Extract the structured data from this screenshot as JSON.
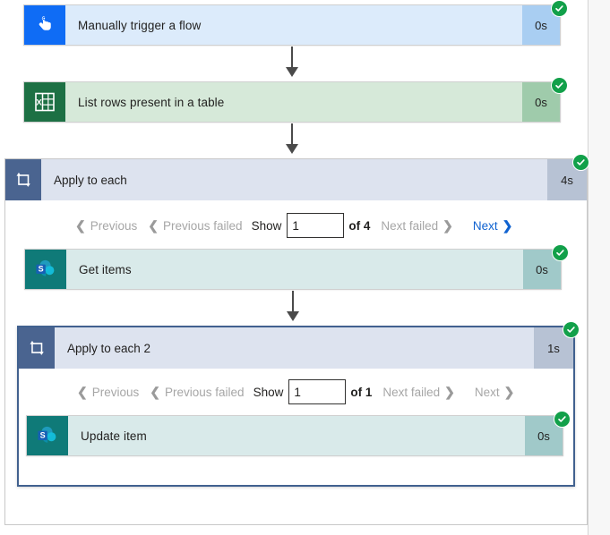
{
  "flow": {
    "steps": [
      {
        "id": "manually-trigger-a-flow",
        "title": "Manually trigger a flow",
        "duration": "0s",
        "icon": "touch-hand-icon",
        "status": "succeeded"
      },
      {
        "id": "list-rows-present-in-a-table",
        "title": "List rows present in a table",
        "duration": "0s",
        "icon": "excel-icon",
        "status": "succeeded"
      },
      {
        "id": "apply-to-each",
        "title": "Apply to each",
        "duration": "4s",
        "icon": "loop-icon",
        "status": "succeeded",
        "pager": {
          "previous_label": "Previous",
          "previous_failed_label": "Previous failed",
          "show_label": "Show",
          "page_value": "1",
          "of_label": "of",
          "total_pages": "4",
          "next_failed_label": "Next failed",
          "next_label": "Next",
          "previous_enabled": false,
          "previous_failed_enabled": false,
          "next_failed_enabled": false,
          "next_enabled": true
        }
      },
      {
        "id": "get-items",
        "title": "Get items",
        "duration": "0s",
        "icon": "sharepoint-icon",
        "status": "succeeded"
      },
      {
        "id": "apply-to-each-2",
        "title": "Apply to each 2",
        "duration": "1s",
        "icon": "loop-icon",
        "status": "succeeded",
        "pager": {
          "previous_label": "Previous",
          "previous_failed_label": "Previous failed",
          "show_label": "Show",
          "page_value": "1",
          "of_label": "of",
          "total_pages": "1",
          "next_failed_label": "Next failed",
          "next_label": "Next",
          "previous_enabled": false,
          "previous_failed_enabled": false,
          "next_failed_enabled": false,
          "next_enabled": false
        }
      },
      {
        "id": "update-item",
        "title": "Update item",
        "duration": "0s",
        "icon": "sharepoint-icon",
        "status": "succeeded"
      }
    ]
  },
  "colors": {
    "trigger_card": "#dcebfb",
    "trigger_duration": "#a9cef2",
    "excel_card": "#d6e9d9",
    "excel_duration": "#9fcbab",
    "sharepoint_card": "#d9eaea",
    "sharepoint_duration": "#a0c9c9",
    "scope_header": "#dde3ef",
    "scope_icon": "#4a6490",
    "scope_duration": "#b7c2d4",
    "success_badge": "#12a04a",
    "link_enabled": "#0f62d0",
    "link_disabled": "#a6a6a6",
    "inner_scope_border": "#41618f"
  },
  "icons": {
    "touch_hand": "touch-hand-icon",
    "excel": "excel-icon",
    "sharepoint": "sharepoint-icon",
    "loop": "loop-icon",
    "check": "check-icon",
    "chevron_left": "chevron-left-icon",
    "chevron_right": "chevron-right-icon",
    "arrow_down": "arrow-down-icon"
  }
}
